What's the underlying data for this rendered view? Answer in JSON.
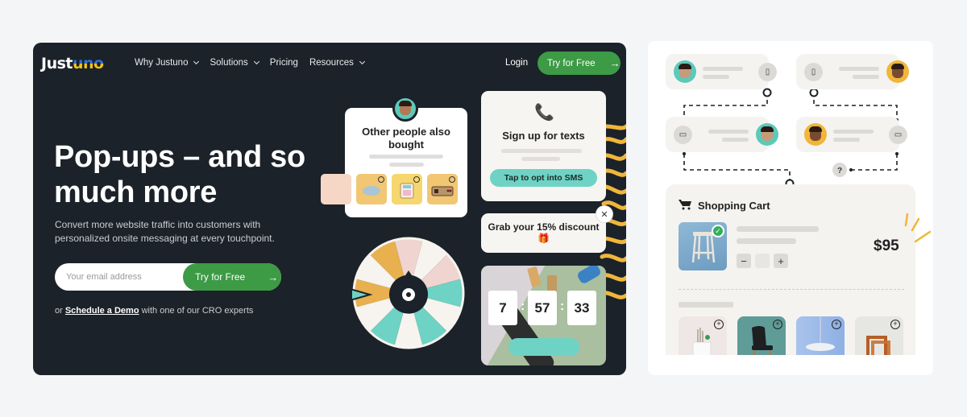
{
  "colors": {
    "page_bg": "#f4f5f7",
    "hero_bg": "#1b2229",
    "brand_green": "#3d9a45",
    "accent_teal": "#6ed3c4",
    "accent_gold": "#f0b63a",
    "pink": "#f0d3d0",
    "logo_blue": "#2f6fd6",
    "logo_yellow": "#f2c21b"
  },
  "header": {
    "logo_part1": "Just",
    "logo_part2": "uno",
    "nav": [
      {
        "label": "Why Justuno",
        "has_dropdown": true
      },
      {
        "label": "Solutions",
        "has_dropdown": true
      },
      {
        "label": "Pricing",
        "has_dropdown": false
      },
      {
        "label": "Resources",
        "has_dropdown": true
      }
    ],
    "login_label": "Login",
    "cta_label": "Try for Free",
    "cta_icon": "arrow-right-icon"
  },
  "hero": {
    "headline": "Pop-ups – and so much more",
    "subtext": "Convert more website traffic into customers with personalized onsite messaging at every touchpoint.",
    "email_placeholder": "Your email address",
    "email_value": "",
    "cta_label": "Try for Free",
    "demo_prefix": "or ",
    "demo_link": "Schedule a Demo",
    "demo_suffix": " with one of our CRO experts"
  },
  "widgets": {
    "also_bought": {
      "title": "Other people also bought",
      "products": [
        "mouse",
        "calculator",
        "game-controller"
      ]
    },
    "sms": {
      "icon": "phone-icon",
      "title": "Sign up for texts",
      "button": "Tap to opt into SMS"
    },
    "discount": {
      "text": "Grab your 15% discount 🎁",
      "close": "✕"
    },
    "countdown": {
      "hours": "7",
      "minutes": "57",
      "seconds": "33",
      "separator": ":"
    },
    "spin_wheel": {
      "segments": [
        "pink",
        "white",
        "pink",
        "teal",
        "white",
        "teal",
        "white",
        "teal",
        "white",
        "gold",
        "white",
        "gold"
      ]
    }
  },
  "journey": {
    "nodes": [
      {
        "avatar": "teal",
        "device": "mobile-icon",
        "device_glyph": "▯"
      },
      {
        "avatar": "gold",
        "device": "mobile-icon",
        "device_glyph": "▯"
      },
      {
        "avatar": "teal",
        "device": "desktop-icon",
        "device_glyph": "▭"
      },
      {
        "avatar": "gold",
        "device": "desktop-icon",
        "device_glyph": "▭"
      }
    ],
    "unknown_label": "?"
  },
  "cart": {
    "title": "Shopping Cart",
    "price": "$95",
    "qty_minus": "−",
    "qty_plus": "+",
    "check": "✓",
    "recommendations": [
      "side-table",
      "black-chair",
      "pendant-lamp",
      "nesting-tables"
    ],
    "rec_plus": "+"
  }
}
